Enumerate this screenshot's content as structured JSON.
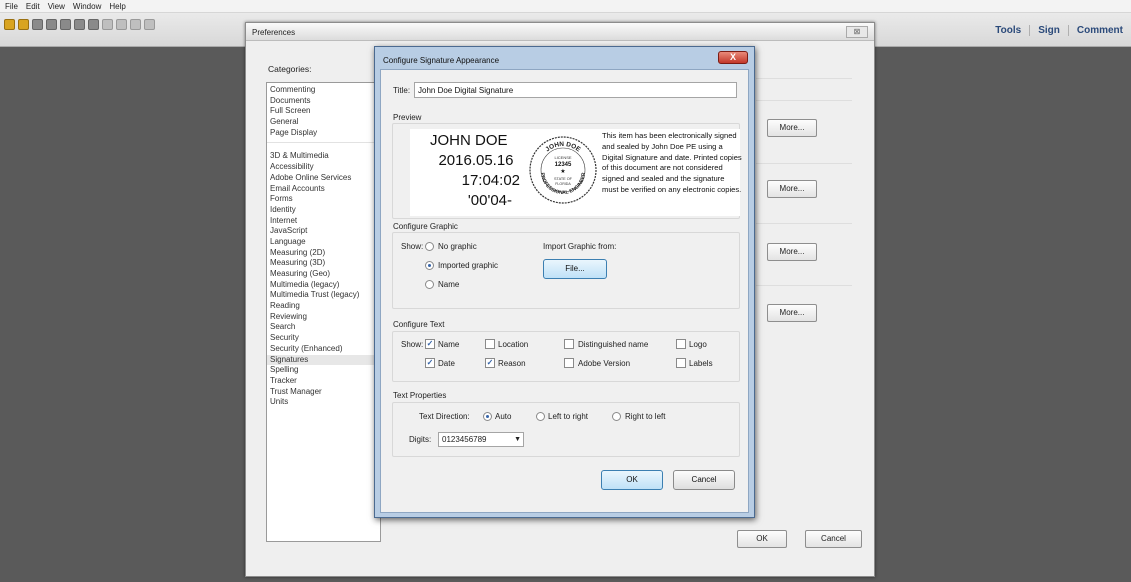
{
  "menu": [
    "File",
    "Edit",
    "View",
    "Window",
    "Help"
  ],
  "toolbar": {
    "right_items": [
      "Tools",
      "Sign",
      "Comment"
    ]
  },
  "prefs": {
    "title": "Preferences",
    "close_label": "⊠",
    "categories_label": "Categories:",
    "categories_top": [
      "Commenting",
      "Documents",
      "Full Screen",
      "General",
      "Page Display"
    ],
    "categories": [
      "3D & Multimedia",
      "Accessibility",
      "Adobe Online Services",
      "Email Accounts",
      "Forms",
      "Identity",
      "Internet",
      "JavaScript",
      "Language",
      "Measuring (2D)",
      "Measuring (3D)",
      "Measuring (Geo)",
      "Multimedia (legacy)",
      "Multimedia Trust (legacy)",
      "Reading",
      "Reviewing",
      "Search",
      "Security",
      "Security (Enhanced)",
      "Signatures",
      "Spelling",
      "Tracker",
      "Trust Manager",
      "Units"
    ],
    "selected": "Signatures",
    "more_label": "More...",
    "ok_label": "OK",
    "cancel_label": "Cancel"
  },
  "dialog": {
    "title": "Configure Signature Appearance",
    "close_label": "X",
    "title_label": "Title:",
    "title_value": "John Doe Digital Signature",
    "preview_label": "Preview",
    "preview": {
      "name": "JOHN DOE",
      "date": "2016.05.16",
      "time": "17:04:02",
      "tz": "'00'04-",
      "seal": {
        "top": "JOHN DOE",
        "license": "LICENSE",
        "number": "12345",
        "state": "STATE OF",
        "state_name": "FLORIDA",
        "bottom": "PROFESSIONAL ENGINEER"
      },
      "text": "This item has been electronically signed and sealed by John Doe PE using a Digital Signature and date. Printed copies of this document are not considered signed and sealed and the signature must be verified on any electronic copies."
    },
    "graphic": {
      "label": "Configure Graphic",
      "show_label": "Show:",
      "options": [
        "No graphic",
        "Imported graphic",
        "Name"
      ],
      "selected": "Imported graphic",
      "import_label": "Import Graphic from:",
      "file_button": "File..."
    },
    "text": {
      "label": "Configure Text",
      "show_label": "Show:",
      "checks": [
        {
          "label": "Name",
          "checked": true
        },
        {
          "label": "Location",
          "checked": false
        },
        {
          "label": "Distinguished name",
          "checked": false
        },
        {
          "label": "Logo",
          "checked": false
        },
        {
          "label": "Date",
          "checked": true
        },
        {
          "label": "Reason",
          "checked": true
        },
        {
          "label": "Adobe Version",
          "checked": false
        },
        {
          "label": "Labels",
          "checked": false
        }
      ]
    },
    "properties": {
      "label": "Text Properties",
      "direction_label": "Text Direction:",
      "directions": [
        "Auto",
        "Left to right",
        "Right to left"
      ],
      "direction_selected": "Auto",
      "digits_label": "Digits:",
      "digits_value": "0123456789"
    },
    "ok_label": "OK",
    "cancel_label": "Cancel"
  }
}
